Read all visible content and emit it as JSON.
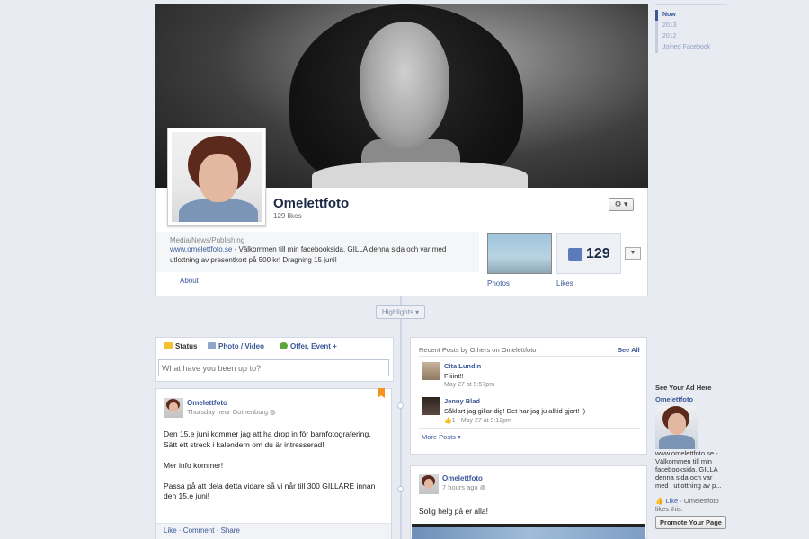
{
  "page": {
    "name": "Omelettfoto",
    "likes_text": "129 likes",
    "category": "Media/News/Publishing",
    "website": "www.omelettfoto.se",
    "about": " - Välkommen till min facebooksida. GILLA denna sida och var med i utlottning av presentkort på 500 kr! Dragning 15 juni!",
    "about_link": "About"
  },
  "tabs": {
    "photos": "Photos",
    "likes": "Likes",
    "likes_count": "129"
  },
  "timeline_nav": [
    "Now",
    "2013",
    "2012",
    "Joined Facebook"
  ],
  "highlights": "Highlights ▾",
  "composer": {
    "status": "Status",
    "photo": "Photo",
    "video": "Video",
    "offer": "Offer, Event +",
    "placeholder": "What have you been up to?"
  },
  "post1": {
    "author": "Omelettfoto",
    "meta": "Thursday near Gothenburg",
    "body": "Den 15.e juni kommer jag att ha drop in för barnfotografering. Sätt ett streck i kalendern om du är intresserad!\n\nMer info kommer!\n\nPassa på att dela detta vidare så vi når till 300 GILLARE innan den 15.e juni!",
    "actions": "Like · Comment · Share"
  },
  "recent": {
    "title": "Recent Posts by Others on Omelettfoto",
    "see_all": "See All",
    "items": [
      {
        "name": "Cita Lundin",
        "text": "Fiiiint!!",
        "meta": "May 27 at 9:57pm"
      },
      {
        "name": "Jenny Blad",
        "text": "Såklart jag gillar dig! Det har jag ju alltid gjort! :)",
        "meta": "1 · May 27 at 9:12pm"
      }
    ],
    "more": "More Posts ▾"
  },
  "post2": {
    "author": "Omelettfoto",
    "meta": "7 hours ago",
    "body": "Solig helg på er alla!"
  },
  "ad": {
    "title": "See Your Ad Here",
    "name": "Omelettfoto",
    "text": "www.omelettfoto.se - Välkommen till min facebooksida. GILLA denna sida och var med i utlottning av p...",
    "like_link": "Like",
    "like_rest": " · Omelettfoto likes this.",
    "promote": "Promote Your Page"
  },
  "colors": {
    "brand_link": "#3b5998",
    "background": "#e9ebf2",
    "bookmark": "#f7941d"
  }
}
